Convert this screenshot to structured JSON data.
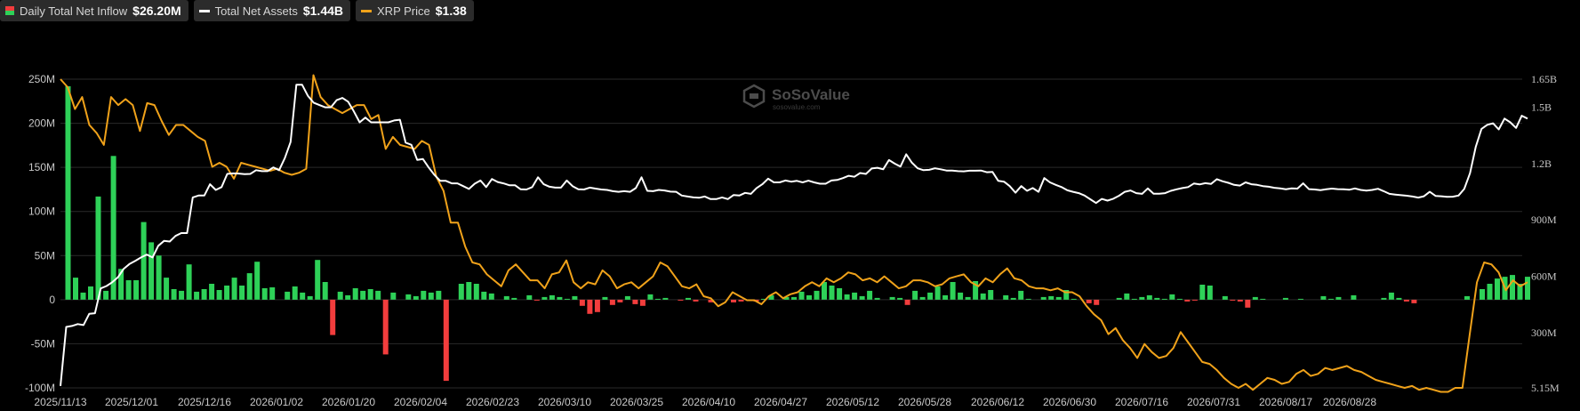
{
  "legend": [
    {
      "label": "Daily Total Net Inflow",
      "value": "$26.20M",
      "color": "#2ed158"
    },
    {
      "label": "Total Net Assets",
      "value": "$1.44B",
      "color": "#ffffff"
    },
    {
      "label": "XRP Price",
      "value": "$1.38",
      "color": "#f0a21a"
    }
  ],
  "watermark": {
    "brand": "SoSoValue",
    "site": "sosovalue.com"
  },
  "chart_data": {
    "type": "bar+line",
    "x_tick_labels": [
      "2025/11/13",
      "2025/12/01",
      "2025/12/16",
      "2026/01/02",
      "2026/01/20",
      "2026/02/04",
      "2026/02/23",
      "2026/03/10",
      "2026/03/25",
      "2026/04/10",
      "2026/04/27",
      "2026/05/12",
      "2026/05/28",
      "2026/06/12",
      "2026/06/30",
      "2026/07/16",
      "2026/07/31",
      "2026/08/17",
      "2026/08/28"
    ],
    "left_axis": {
      "ticks": [
        "250M",
        "200M",
        "150M",
        "100M",
        "50M",
        "0",
        "-50M",
        "-100M"
      ],
      "values": [
        250,
        200,
        150,
        100,
        50,
        0,
        -50,
        -100
      ],
      "range_millions": [
        -100,
        250
      ]
    },
    "right_axis": {
      "ticks": [
        "1.65B",
        "1.5B",
        "1.2B",
        "900M",
        "600M",
        "300M",
        "5.15M"
      ],
      "values": [
        1650,
        1500,
        1200,
        900,
        600,
        300,
        5.15
      ],
      "range_millions": [
        5.15,
        1650
      ]
    },
    "bar_colors": {
      "positive": "#2ed158",
      "negative": "#f23d3d"
    },
    "series": [
      {
        "name": "Daily Total Net Inflow",
        "unit": "USD millions",
        "values": [
          0,
          242,
          25,
          8,
          15,
          117,
          10,
          163,
          35,
          22,
          22,
          88,
          65,
          50,
          25,
          12,
          10,
          40,
          9,
          12,
          18,
          11,
          16,
          25,
          16,
          30,
          43,
          13,
          14,
          0,
          9,
          15,
          8,
          4,
          45,
          20,
          -40,
          9,
          5,
          13,
          10,
          12,
          10,
          -62,
          8,
          0,
          6,
          4,
          10,
          8,
          10,
          -92,
          0,
          18,
          20,
          18,
          9,
          7,
          0,
          4,
          2,
          0,
          5,
          -1,
          3,
          5,
          3,
          1,
          4,
          -7,
          -16,
          -14,
          3,
          -6,
          -3,
          4,
          -5,
          -7,
          6,
          1,
          2,
          0,
          -1,
          2,
          -2,
          0,
          -3,
          0,
          0,
          -3,
          -2,
          0,
          -2,
          1,
          5,
          0,
          3,
          3,
          9,
          5,
          10,
          20,
          16,
          13,
          6,
          8,
          4,
          10,
          2,
          0,
          3,
          2,
          -6,
          10,
          3,
          8,
          15,
          5,
          20,
          8,
          3,
          21,
          7,
          11,
          0,
          5,
          2,
          10,
          1,
          0,
          3,
          4,
          3,
          11,
          1,
          0,
          -4,
          -6,
          0,
          0,
          2,
          7,
          1,
          3,
          5,
          2,
          1,
          6,
          1,
          -2,
          -1,
          17,
          16,
          0,
          4,
          -1,
          -2,
          -9,
          3,
          1,
          0,
          0,
          2,
          0,
          1,
          0,
          0,
          4,
          1,
          3,
          0,
          5,
          0,
          0,
          0,
          2,
          8,
          2,
          -2,
          -4,
          0,
          0,
          0,
          0,
          0,
          0,
          4,
          0,
          12,
          18,
          24,
          26,
          28,
          18,
          26
        ]
      },
      {
        "name": "Total Net Assets",
        "unit": "USD millions",
        "values": [
          15,
          330,
          335,
          345,
          340,
          400,
          403,
          535,
          548,
          568,
          595,
          640,
          665,
          682,
          700,
          715,
          700,
          762,
          788,
          785,
          815,
          830,
          830,
          1020,
          1030,
          1030,
          1090,
          1060,
          1075,
          1145,
          1148,
          1147,
          1144,
          1145,
          1165,
          1160,
          1160,
          1180,
          1165,
          1230,
          1315,
          1620,
          1620,
          1562,
          1525,
          1512,
          1500,
          1500,
          1538,
          1550,
          1530,
          1478,
          1420,
          1445,
          1420,
          1420,
          1420,
          1420,
          1430,
          1434,
          1312,
          1300,
          1220,
          1225,
          1180,
          1140,
          1108,
          1108,
          1095,
          1095,
          1080,
          1065,
          1093,
          1110,
          1075,
          1118,
          1102,
          1095,
          1085,
          1085,
          1063,
          1062,
          1075,
          1127,
          1090,
          1077,
          1072,
          1072,
          1110,
          1080,
          1063,
          1062,
          1072,
          1067,
          1062,
          1060,
          1053,
          1050,
          1053,
          1050,
          1070,
          1127,
          1055,
          1053,
          1060,
          1057,
          1051,
          1050,
          1030,
          1025,
          1020,
          1018,
          1025,
          1011,
          1011,
          1020,
          1011,
          1033,
          1030,
          1044,
          1039,
          1070,
          1090,
          1120,
          1100,
          1100,
          1110,
          1104,
          1108,
          1100,
          1109,
          1100,
          1093,
          1093,
          1110,
          1113,
          1123,
          1135,
          1130,
          1150,
          1145,
          1174,
          1178,
          1170,
          1219,
          1200,
          1184,
          1250,
          1205,
          1175,
          1165,
          1167,
          1175,
          1170,
          1163,
          1163,
          1160,
          1159,
          1162,
          1162,
          1163,
          1154,
          1156,
          1108,
          1104,
          1080,
          1045,
          1080,
          1055,
          1070,
          1050,
          1123,
          1100,
          1087,
          1075,
          1058,
          1050,
          1043,
          1030,
          1010,
          990,
          1012,
          1003,
          1013,
          1029,
          1050,
          1057,
          1043,
          1039,
          1068,
          1040,
          1040,
          1043,
          1055,
          1063,
          1070,
          1075,
          1094,
          1089,
          1096,
          1092,
          1117,
          1106,
          1098,
          1087,
          1083,
          1100,
          1090,
          1087,
          1080,
          1077,
          1071,
          1068,
          1063,
          1068,
          1067,
          1095,
          1064,
          1062,
          1059,
          1063,
          1067,
          1064,
          1063,
          1061,
          1068,
          1060,
          1056,
          1060,
          1066,
          1053,
          1039,
          1035,
          1032,
          1029,
          1025,
          1019,
          1026,
          1050,
          1028,
          1026,
          1023,
          1024,
          1030,
          1065,
          1149,
          1290,
          1385,
          1407,
          1415,
          1382,
          1440,
          1420,
          1390,
          1455,
          1440
        ]
      },
      {
        "name": "XRP Price",
        "unit": "USD",
        "values": [
          2.4,
          2.36,
          2.25,
          2.31,
          2.17,
          2.13,
          2.07,
          2.31,
          2.27,
          2.3,
          2.27,
          2.14,
          2.28,
          2.27,
          2.19,
          2.12,
          2.17,
          2.17,
          2.14,
          2.11,
          2.09,
          1.96,
          1.98,
          1.96,
          1.9,
          1.98,
          1.97,
          1.96,
          1.95,
          1.94,
          1.95,
          1.93,
          1.92,
          1.93,
          1.95,
          2.42,
          2.31,
          2.27,
          2.25,
          2.23,
          2.25,
          2.27,
          2.27,
          2.2,
          2.22,
          2.05,
          2.11,
          2.07,
          2.06,
          2.05,
          2.09,
          2.07,
          1.91,
          1.84,
          1.68,
          1.68,
          1.56,
          1.48,
          1.47,
          1.42,
          1.39,
          1.36,
          1.44,
          1.47,
          1.43,
          1.39,
          1.39,
          1.35,
          1.42,
          1.43,
          1.49,
          1.38,
          1.35,
          1.38,
          1.37,
          1.44,
          1.41,
          1.35,
          1.37,
          1.38,
          1.35,
          1.38,
          1.41,
          1.48,
          1.46,
          1.41,
          1.36,
          1.35,
          1.37,
          1.31,
          1.3,
          1.26,
          1.28,
          1.33,
          1.31,
          1.29,
          1.29,
          1.27,
          1.31,
          1.33,
          1.3,
          1.32,
          1.33,
          1.36,
          1.38,
          1.36,
          1.4,
          1.38,
          1.4,
          1.43,
          1.42,
          1.39,
          1.4,
          1.38,
          1.41,
          1.38,
          1.35,
          1.36,
          1.39,
          1.39,
          1.38,
          1.36,
          1.37,
          1.4,
          1.41,
          1.42,
          1.38,
          1.36,
          1.4,
          1.38,
          1.42,
          1.45,
          1.4,
          1.39,
          1.36,
          1.35,
          1.35,
          1.34,
          1.35,
          1.33,
          1.33,
          1.31,
          1.26,
          1.22,
          1.19,
          1.12,
          1.15,
          1.09,
          1.05,
          1.0,
          1.07,
          1.03,
          1.0,
          1.01,
          1.05,
          1.13,
          1.08,
          1.03,
          0.98,
          0.97,
          0.94,
          0.9,
          0.87,
          0.85,
          0.87,
          0.84,
          0.87,
          0.9,
          0.89,
          0.87,
          0.88,
          0.92,
          0.94,
          0.91,
          0.92,
          0.95,
          0.94,
          0.95,
          0.96,
          0.94,
          0.93,
          0.91,
          0.89,
          0.88,
          0.87,
          0.86,
          0.85,
          0.86,
          0.84,
          0.85,
          0.84,
          0.83,
          0.83,
          0.85,
          0.85,
          1.12,
          1.38,
          1.48,
          1.47,
          1.43,
          1.34,
          1.39,
          1.36,
          1.38
        ]
      }
    ],
    "price_scale_usd": [
      0.85,
      2.4
    ],
    "grid": "horizontal",
    "legend_position": "top-left"
  }
}
